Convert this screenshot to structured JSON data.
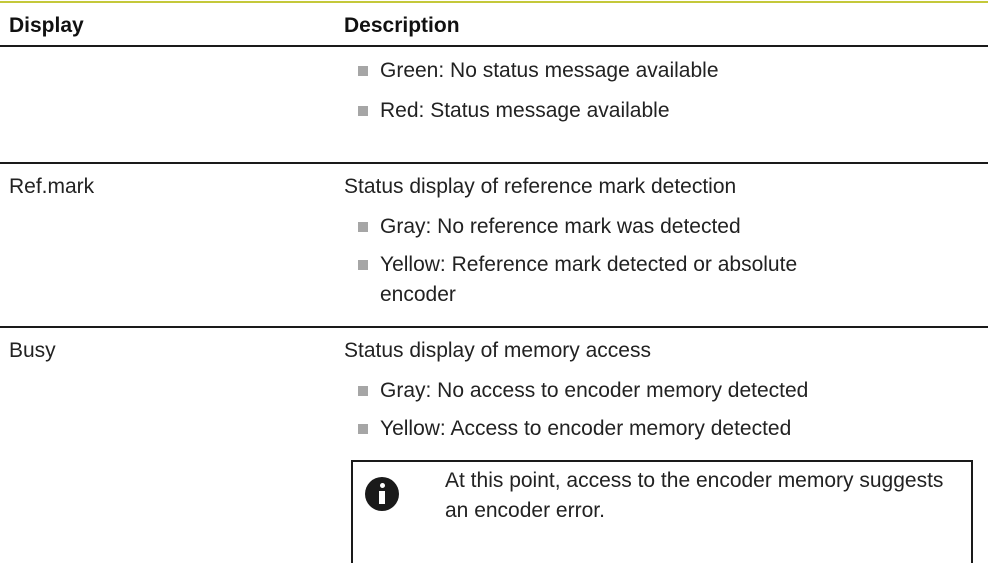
{
  "table": {
    "header": {
      "col1": "Display",
      "col2": "Description"
    },
    "rows": [
      {
        "display": "",
        "description": "",
        "bullets": [
          "Green: No status message available",
          "Red: Status message available"
        ]
      },
      {
        "display": "Ref.mark",
        "description": "Status display of reference mark detection",
        "bullets": [
          "Gray: No reference mark was detected",
          "Yellow: Reference mark detected or absolute encoder"
        ]
      },
      {
        "display": "Busy",
        "description": "Status display of memory access",
        "bullets": [
          "Gray: No access to encoder memory detected",
          "Yellow: Access to encoder memory detected"
        ]
      }
    ],
    "note": {
      "icon": "info-icon",
      "text": "At this point, access to the encoder memory suggests an encoder error."
    }
  },
  "colors": {
    "header_rule": "#c4c83a",
    "bullet": "#a6a6a6",
    "text": "#222222"
  }
}
